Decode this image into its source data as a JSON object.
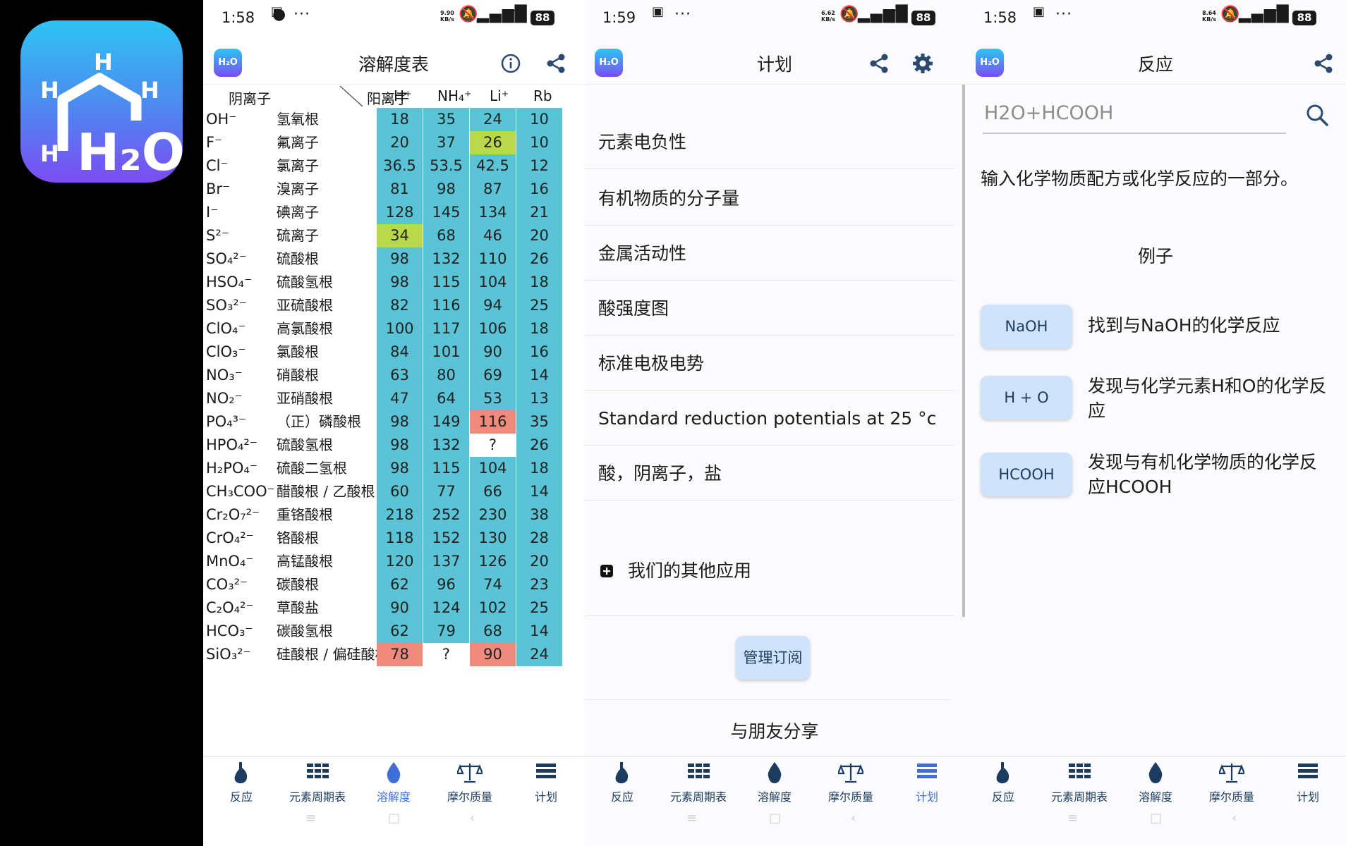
{
  "app_icon": {
    "h_top": "H",
    "h_left": "H",
    "h_right": "H",
    "h_bottom": "H",
    "main": "H₂O"
  },
  "status_bars": [
    {
      "time": "1:58",
      "rate_top": "9.90",
      "rate_bottom": "KB/s",
      "battery": "88"
    },
    {
      "time": "1:59",
      "rate_top": "6.62",
      "rate_bottom": "KB/s",
      "battery": "88"
    },
    {
      "time": "1:58",
      "rate_top": "8.64",
      "rate_bottom": "KB/s",
      "battery": "88"
    }
  ],
  "logo_text": "H₂O",
  "solubility": {
    "title": "溶解度表",
    "header_anion": "阴离子",
    "header_cation": "阳离子",
    "cations": [
      "H⁺",
      "NH₄⁺",
      "Li⁺",
      "Rb"
    ],
    "rows": [
      {
        "formula": "OH⁻",
        "name": "氢氧根",
        "values": [
          "18",
          "35",
          "24",
          "10"
        ]
      },
      {
        "formula": "F⁻",
        "name": "氟离子",
        "values": [
          "20",
          "37",
          "26",
          "10"
        ]
      },
      {
        "formula": "Cl⁻",
        "name": "氯离子",
        "values": [
          "36.5",
          "53.5",
          "42.5",
          "12"
        ]
      },
      {
        "formula": "Br⁻",
        "name": "溴离子",
        "values": [
          "81",
          "98",
          "87",
          "16"
        ]
      },
      {
        "formula": "I⁻",
        "name": "碘离子",
        "values": [
          "128",
          "145",
          "134",
          "21"
        ]
      },
      {
        "formula": "S²⁻",
        "name": "硫离子",
        "values": [
          "34",
          "68",
          "46",
          "20"
        ]
      },
      {
        "formula": "SO₄²⁻",
        "name": "硫酸根",
        "values": [
          "98",
          "132",
          "110",
          "26"
        ]
      },
      {
        "formula": "HSO₄⁻",
        "name": "硫酸氢根",
        "values": [
          "98",
          "115",
          "104",
          "18"
        ]
      },
      {
        "formula": "SO₃²⁻",
        "name": "亚硫酸根",
        "values": [
          "82",
          "116",
          "94",
          "25"
        ]
      },
      {
        "formula": "ClO₄⁻",
        "name": "高氯酸根",
        "values": [
          "100",
          "117",
          "106",
          "18"
        ]
      },
      {
        "formula": "ClO₃⁻",
        "name": "氯酸根",
        "values": [
          "84",
          "101",
          "90",
          "16"
        ]
      },
      {
        "formula": "NO₃⁻",
        "name": "硝酸根",
        "values": [
          "63",
          "80",
          "69",
          "14"
        ]
      },
      {
        "formula": "NO₂⁻",
        "name": "亚硝酸根",
        "values": [
          "47",
          "64",
          "53",
          "13"
        ]
      },
      {
        "formula": "PO₄³⁻",
        "name": "（正）磷酸根",
        "values": [
          "98",
          "149",
          "116",
          "35"
        ]
      },
      {
        "formula": "HPO₄²⁻",
        "name": "硫酸氢根",
        "values": [
          "98",
          "132",
          "?",
          "26"
        ]
      },
      {
        "formula": "H₂PO₄⁻",
        "name": "硫酸二氢根",
        "values": [
          "98",
          "115",
          "104",
          "18"
        ]
      },
      {
        "formula": "CH₃COO⁻",
        "name": "醋酸根 / 乙酸根",
        "values": [
          "60",
          "77",
          "66",
          "14"
        ]
      },
      {
        "formula": "Cr₂O₇²⁻",
        "name": "重铬酸根",
        "values": [
          "218",
          "252",
          "230",
          "38"
        ]
      },
      {
        "formula": "CrO₄²⁻",
        "name": "铬酸根",
        "values": [
          "118",
          "152",
          "130",
          "28"
        ]
      },
      {
        "formula": "MnO₄⁻",
        "name": "高锰酸根",
        "values": [
          "120",
          "137",
          "126",
          "20"
        ]
      },
      {
        "formula": "CO₃²⁻",
        "name": "碳酸根",
        "values": [
          "62",
          "96",
          "74",
          "23"
        ]
      },
      {
        "formula": "C₂O₄²⁻",
        "name": "草酸盐",
        "values": [
          "90",
          "124",
          "102",
          "25"
        ]
      },
      {
        "formula": "HCO₃⁻",
        "name": "碳酸氢根",
        "values": [
          "62",
          "79",
          "68",
          "14"
        ]
      },
      {
        "formula": "SiO₃²⁻",
        "name": "硅酸根 / 偏硅酸根",
        "values": [
          "78",
          "?",
          "90",
          "24"
        ]
      }
    ],
    "cell_colors": {
      "soluble": "#5bc3d6",
      "slight": "#b9d84a",
      "insoluble": "#f08a7c",
      "unknown": "#ffffff"
    },
    "highlights": [
      {
        "row": 1,
        "col": 2,
        "kind": "slight"
      },
      {
        "row": 5,
        "col": 0,
        "kind": "slight"
      },
      {
        "row": 13,
        "col": 2,
        "kind": "insoluble"
      },
      {
        "row": 14,
        "col": 2,
        "kind": "unknown"
      },
      {
        "row": 23,
        "col": 0,
        "kind": "insoluble"
      },
      {
        "row": 23,
        "col": 1,
        "kind": "unknown"
      },
      {
        "row": 23,
        "col": 2,
        "kind": "insoluble"
      }
    ]
  },
  "plan": {
    "title": "计划",
    "items": [
      "元素电负性",
      "有机物质的分子量",
      "金属活动性",
      "酸强度图",
      "标准电极电势",
      "Standard reduction potentials at 25 °c",
      "酸，阴离子，盐"
    ],
    "other_apps": "我们的其他应用",
    "manage_sub": "管理订阅",
    "share": "与朋友分享"
  },
  "reaction": {
    "title": "反应",
    "search_value": "H2O+HCOOH",
    "hint": "输入化学物质配方或化学反应的一部分。",
    "examples_heading": "例子",
    "examples": [
      {
        "button": "NaOH",
        "text": "找到与NaOH的化学反应"
      },
      {
        "button": "H + O",
        "text": "发现与化学元素H和O的化学反应"
      },
      {
        "button": "HCOOH",
        "text": "发现与有机化学物质的化学反应HCOOH"
      }
    ]
  },
  "nav": {
    "items": [
      "反应",
      "元素周期表",
      "溶解度",
      "摩尔质量",
      "计划"
    ],
    "active_color": "#3f6fd6",
    "color": "#1b3c5e"
  }
}
